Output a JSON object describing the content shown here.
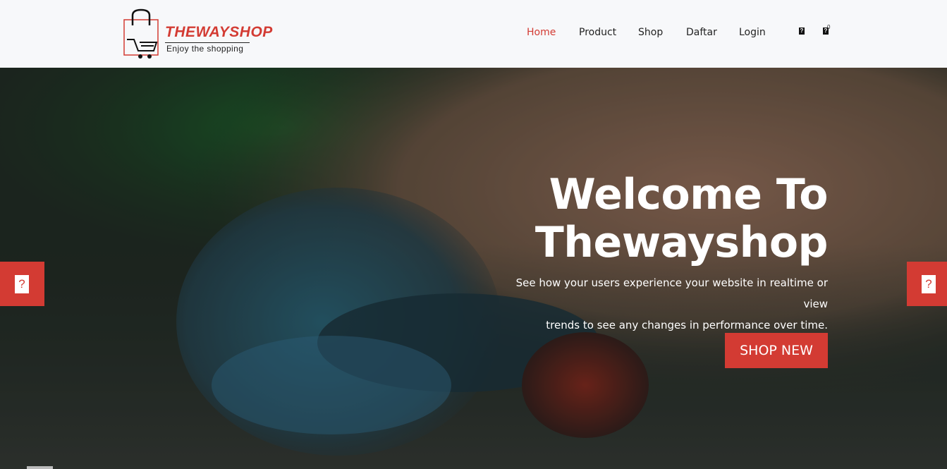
{
  "brand": {
    "name": "THEWAYSHOP",
    "tagline": "Enjoy the shopping",
    "accent": "#d33b33",
    "icon": "shopping-bag-cart-logo"
  },
  "nav": {
    "items": [
      {
        "label": "Home",
        "active": true
      },
      {
        "label": "Product",
        "active": false
      },
      {
        "label": "Shop",
        "active": false
      },
      {
        "label": "Daftar",
        "active": false
      },
      {
        "label": "Login",
        "active": false
      }
    ],
    "icons": [
      "search-icon",
      "cart-icon"
    ],
    "cart_count": "0"
  },
  "hero": {
    "title_line1": "Welcome To",
    "title_line2": "Thewayshop",
    "subtitle_line1": "See how your users experience your website in realtime or view",
    "subtitle_line2": "trends to see any changes in performance over time.",
    "cta_label": "SHOP NEW",
    "background": "betta-fish-photo"
  },
  "slider": {
    "prev_icon": "prev-arrow-icon",
    "next_icon": "next-arrow-icon"
  }
}
